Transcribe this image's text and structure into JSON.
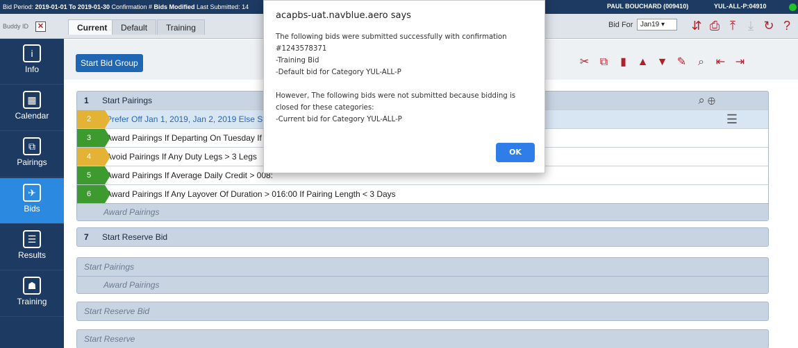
{
  "topbar": {
    "period_label": "Bid Period:",
    "period_value": "2019-01-01 To 2019-01-30",
    "confirmation_label": "Confirmation #",
    "status": "Bids Modified",
    "last_submitted": "Last Submitted: 14",
    "user": "PAUL BOUCHARD (009410)",
    "category": "YUL-ALL-P:04910"
  },
  "tabbar": {
    "buddy_label": "Buddy ID",
    "tabs": [
      "Current",
      "Default",
      "Training"
    ],
    "bid_for_label": "Bid For",
    "bid_for_value": "Jan19"
  },
  "sidebar": {
    "items": [
      {
        "label": "Info",
        "icon": "info-icon"
      },
      {
        "label": "Calendar",
        "icon": "calendar-icon"
      },
      {
        "label": "Pairings",
        "icon": "pairings-icon"
      },
      {
        "label": "Bids",
        "icon": "bids-icon"
      },
      {
        "label": "Results",
        "icon": "results-icon"
      },
      {
        "label": "Training",
        "icon": "training-icon"
      }
    ]
  },
  "main": {
    "start_bid_group": "Start Bid Group",
    "group1": {
      "num": "1",
      "title": "Start Pairings",
      "rows": [
        {
          "num": "2",
          "text": "Prefer Off Jan 1, 2019, Jan 2, 2019 Else Start",
          "color": "gold"
        },
        {
          "num": "3",
          "text": "Award Pairings If Departing On Tuesday If An",
          "color": "green"
        },
        {
          "num": "4",
          "text": "Avoid Pairings If Any Duty Legs > 3 Legs",
          "color": "gold"
        },
        {
          "num": "5",
          "text": "Award Pairings If Average Daily Credit > 008:",
          "color": "green"
        },
        {
          "num": "6",
          "text": "Award Pairings If Any Layover Of Duration > 016:00 If Pairing Length < 3 Days",
          "color": "green"
        }
      ],
      "footer": "Award Pairings"
    },
    "group7": {
      "num": "7",
      "title": "Start Reserve Bid"
    },
    "group_empty1": {
      "title": "Start Pairings",
      "sub": "Award Pairings"
    },
    "group_empty2": {
      "title": "Start Reserve Bid"
    },
    "group_empty3": {
      "title": "Start Reserve"
    }
  },
  "dialog": {
    "title": "acapbs-uat.navblue.aero says",
    "lines": [
      "The following bids were submitted successfully with confirmation",
      "#1243578371",
      "-Training Bid",
      "-Default bid for Category YUL-ALL-P",
      "",
      "However, The following bids were not submitted because bidding is",
      "closed for these categories:",
      "-Current bid for Category YUL-ALL-P"
    ],
    "ok": "OK"
  },
  "colors": {
    "navy": "#1d3a63",
    "active_nav": "#2b8ae0",
    "accent_red": "#b41d2a",
    "green_badge": "#3d9a2f",
    "gold_badge": "#e4b234",
    "ok_button": "#2f7de8"
  }
}
